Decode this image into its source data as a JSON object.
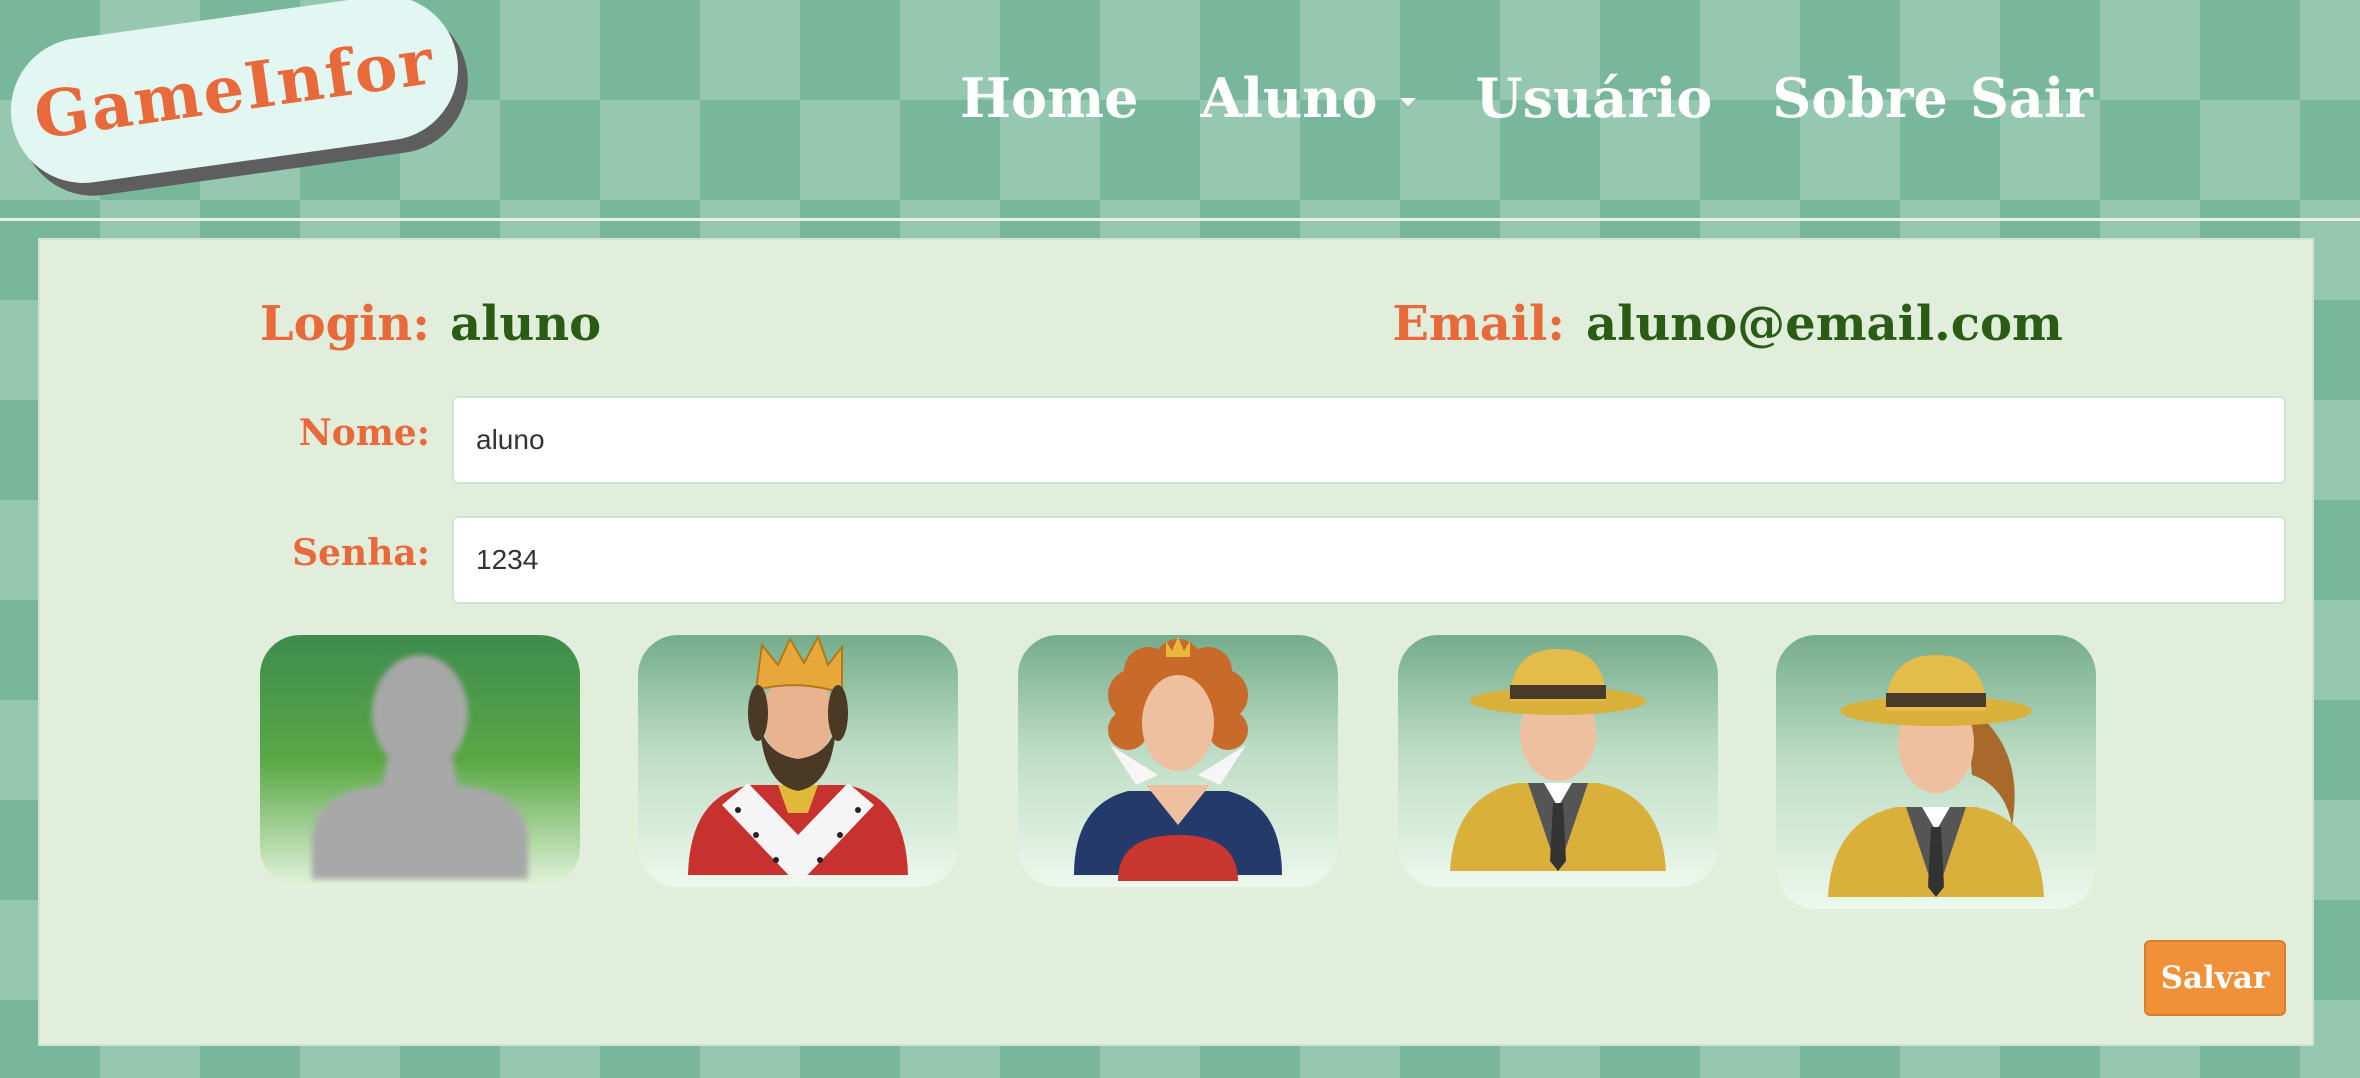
{
  "brand": {
    "logo_text": "GameInfor"
  },
  "nav": {
    "home": "Home",
    "aluno": "Aluno",
    "usuario": "Usuário",
    "sobre": "Sobre",
    "sair": "Sair"
  },
  "profile": {
    "login_label": "Login:",
    "login_value": "aluno",
    "email_label": "Email:",
    "email_value": "aluno@email.com",
    "nome_label": "Nome:",
    "nome_value": "aluno",
    "senha_label": "Senha:",
    "senha_value": "1234"
  },
  "avatars": [
    {
      "icon": "default-silhouette-avatar"
    },
    {
      "icon": "king-avatar"
    },
    {
      "icon": "queen-avatar"
    },
    {
      "icon": "detective-man-avatar"
    },
    {
      "icon": "detective-woman-avatar"
    }
  ],
  "actions": {
    "save_label": "Salvar"
  },
  "colors": {
    "accent_orange": "#e8693a",
    "value_green": "#2b5c16",
    "panel_bg": "#e2eedc",
    "button_orange": "#f0913a",
    "background_green": "#78b79b"
  }
}
